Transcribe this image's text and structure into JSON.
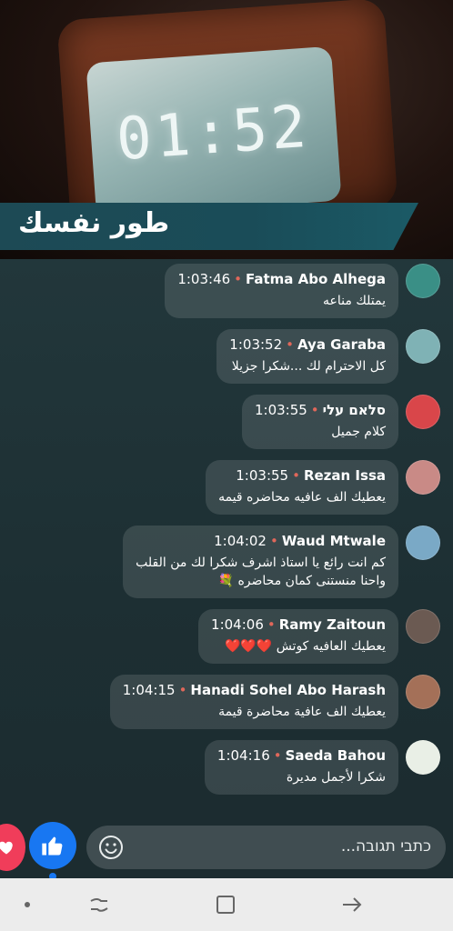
{
  "video": {
    "clock_time": "01:52",
    "banner_title": "طور نفسك"
  },
  "comments": [
    {
      "name": "Fatma Abo Alhega",
      "time": "1:03:46",
      "text": "يمتلك مناعه",
      "avatar_color": "#3a8f86"
    },
    {
      "name": "Aya Garaba",
      "time": "1:03:52",
      "text": "كل الاحترام لك ...شكرا جزيلا",
      "avatar_color": "#7fb2b5"
    },
    {
      "name": "סלאם עלי",
      "time": "1:03:55",
      "text": "كلام جميل",
      "avatar_color": "#d9464a"
    },
    {
      "name": "Rezan Issa",
      "time": "1:03:55",
      "text": "يعطيك الف عافيه محاضره  قيمه",
      "avatar_color": "#c98a86"
    },
    {
      "name": "Waud Mtwale",
      "time": "1:04:02",
      "text": "كم انت رائع يا استاذ اشرف شكرا لك من القلب\nواحنا منستنى كمان محاضره 💐",
      "avatar_color": "#7aa9c6"
    },
    {
      "name": "Ramy Zaitoun",
      "time": "1:04:06",
      "text": "يعطيك العافيه كوتش ❤️❤️❤️",
      "avatar_color": "#6b5a52"
    },
    {
      "name": "Hanadi Sohel Abo Harash",
      "time": "1:04:15",
      "text": "يعطيك الف عافية محاضرة قيمة",
      "avatar_color": "#a47058"
    },
    {
      "name": "Saeda Bahou",
      "time": "1:04:16",
      "text": "شكرا لأجمل مديرة",
      "avatar_color": "#e9efe6"
    }
  ],
  "composer": {
    "placeholder": "כתבי תגובה..."
  },
  "icons": {
    "heart": "heart-icon",
    "like": "thumbs-up-icon",
    "emoji": "smiley-icon",
    "nav_dot": "dot-icon",
    "nav_recents": "recents-icon",
    "nav_home": "home-square-icon",
    "nav_back": "back-arrow-icon"
  },
  "colors": {
    "like_blue": "#1877f2",
    "heart_red": "#f03d5a",
    "separator_dot": "#e0675a"
  }
}
